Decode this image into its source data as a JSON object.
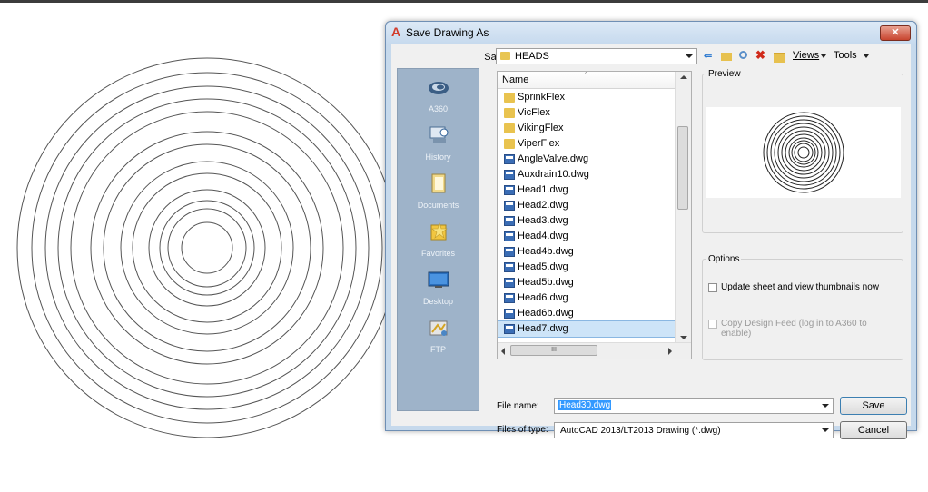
{
  "dialog": {
    "title": "Save Drawing As",
    "close_glyph": "✕",
    "app_icon_glyph": "A"
  },
  "save_in": {
    "label": "Save in:",
    "value": "HEADS"
  },
  "toolbar": {
    "back_glyph": "⇐",
    "delete_glyph": "✖",
    "views_label": "Views",
    "tools_label": "Tools"
  },
  "places": [
    {
      "label": "A360",
      "icon": "a360-icon"
    },
    {
      "label": "History",
      "icon": "history-icon"
    },
    {
      "label": "Documents",
      "icon": "documents-icon"
    },
    {
      "label": "Favorites",
      "icon": "favorites-icon"
    },
    {
      "label": "Desktop",
      "icon": "desktop-icon"
    },
    {
      "label": "FTP",
      "icon": "ftp-icon"
    }
  ],
  "file_list": {
    "column_name": "Name",
    "rows": [
      {
        "name": "SprinkFlex",
        "type": "folder"
      },
      {
        "name": "VicFlex",
        "type": "folder"
      },
      {
        "name": "VikingFlex",
        "type": "folder"
      },
      {
        "name": "ViperFlex",
        "type": "folder"
      },
      {
        "name": "AngleValve.dwg",
        "type": "dwg"
      },
      {
        "name": "Auxdrain10.dwg",
        "type": "dwg"
      },
      {
        "name": "Head1.dwg",
        "type": "dwg"
      },
      {
        "name": "Head2.dwg",
        "type": "dwg"
      },
      {
        "name": "Head3.dwg",
        "type": "dwg"
      },
      {
        "name": "Head4.dwg",
        "type": "dwg"
      },
      {
        "name": "Head4b.dwg",
        "type": "dwg"
      },
      {
        "name": "Head5.dwg",
        "type": "dwg"
      },
      {
        "name": "Head5b.dwg",
        "type": "dwg"
      },
      {
        "name": "Head6.dwg",
        "type": "dwg"
      },
      {
        "name": "Head6b.dwg",
        "type": "dwg"
      },
      {
        "name": "Head7.dwg",
        "type": "dwg",
        "selected": true
      }
    ],
    "hscroll_glyph": "III"
  },
  "preview": {
    "label": "Preview"
  },
  "options": {
    "label": "Options",
    "update_thumbnails": "Update sheet and view thumbnails now",
    "update_thumbnails_checked": false,
    "copy_design_feed": "Copy Design Feed (log in to A360 to enable)",
    "copy_design_feed_checked": false
  },
  "file_name": {
    "label": "File name:",
    "value": "Head30.dwg"
  },
  "file_type": {
    "label": "Files of type:",
    "value": "AutoCAD 2013/LT2013 Drawing (*.dwg)"
  },
  "buttons": {
    "save": "Save",
    "cancel": "Cancel"
  },
  "colors": {
    "title_bar": "#c7daee",
    "places_bar": "#9eb3c9",
    "selection": "#cde4f8",
    "close_button": "#c8452f"
  }
}
